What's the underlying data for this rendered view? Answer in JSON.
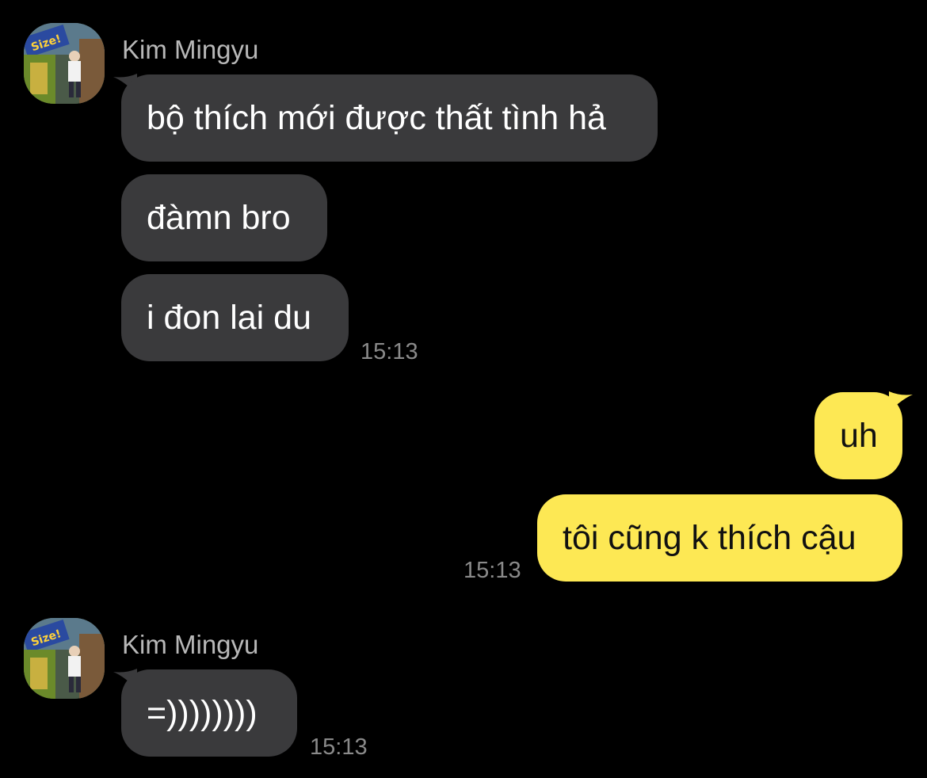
{
  "colors": {
    "background": "#000000",
    "incoming_bubble": "#3a3a3c",
    "outgoing_bubble": "#fde854",
    "name_text": "#b8b8b8",
    "timestamp_text": "#8a8a8a"
  },
  "groups": [
    {
      "sender": "Kim Mingyu",
      "messages": [
        {
          "text": "bộ thích mới được thất tình hả"
        },
        {
          "text": "đàmn bro"
        },
        {
          "text": "i đon lai du"
        }
      ],
      "time": "15:13"
    },
    {
      "sender": "me",
      "messages": [
        {
          "text": "uh"
        },
        {
          "text": "tôi cũng k thích cậu"
        }
      ],
      "time": "15:13"
    },
    {
      "sender": "Kim Mingyu",
      "messages": [
        {
          "text": "=))))))))"
        }
      ],
      "time": "15:13"
    }
  ]
}
